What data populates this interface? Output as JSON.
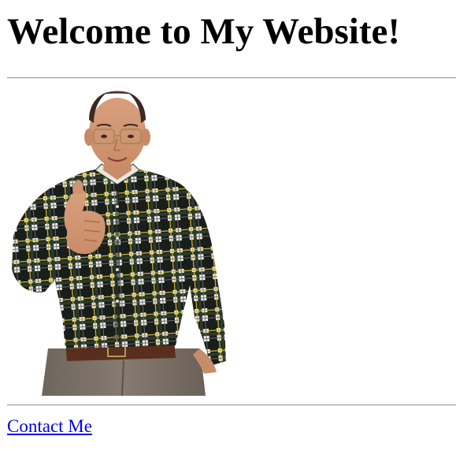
{
  "heading": "Welcome to My Website!",
  "image": {
    "subject": "man in plaid shirt giving thumbs up"
  },
  "contact_link": {
    "label": "Contact Me"
  },
  "colors": {
    "link": "#0000ee",
    "rule": "#9a9a9a",
    "background": "#ffffff"
  }
}
